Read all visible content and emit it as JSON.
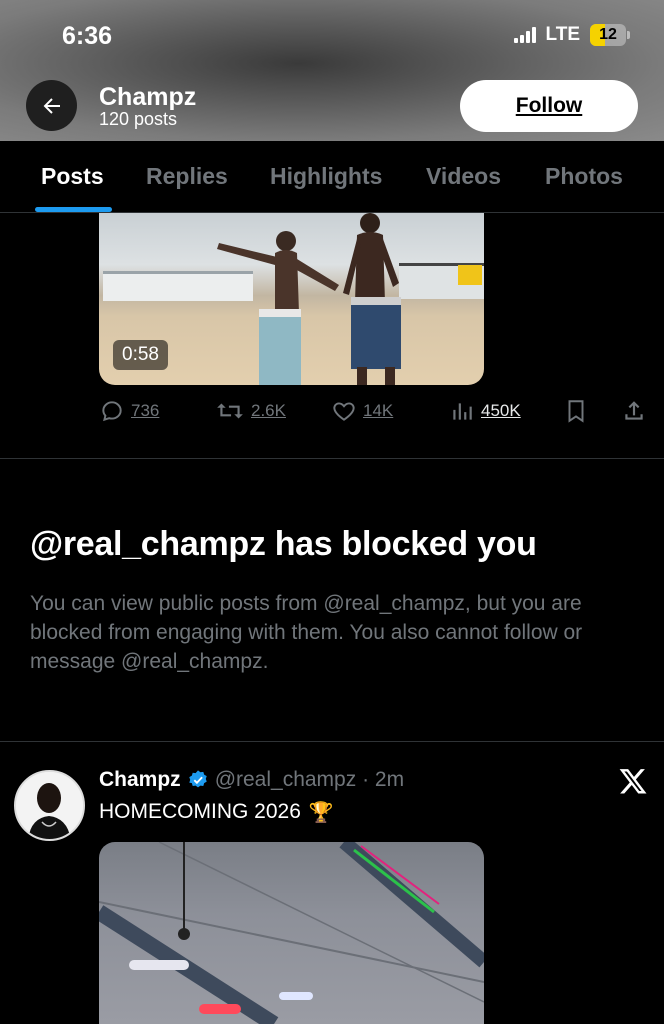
{
  "status_bar": {
    "time": "6:36",
    "network": "LTE",
    "battery": "12",
    "battery_level_percent": 12,
    "signal_bars": 4,
    "battery_color": "#f5d200"
  },
  "header": {
    "back_icon": "arrow-left-icon",
    "name": "Champz",
    "posts_count": "120 posts",
    "follow_label": "Follow"
  },
  "tabs": [
    {
      "label": "Posts",
      "active": true
    },
    {
      "label": "Replies",
      "active": false
    },
    {
      "label": "Highlights",
      "active": false
    },
    {
      "label": "Videos",
      "active": false
    },
    {
      "label": "Photos",
      "active": false
    }
  ],
  "post1": {
    "video_duration": "0:58",
    "actions": {
      "replies": "736",
      "reposts": "2.6K",
      "likes": "14K",
      "views": "450K"
    }
  },
  "blocked": {
    "title": "@real_champz has blocked you",
    "description": "You can view public posts from @real_champz, but you are blocked from engaging with them. You also cannot follow or message @real_champz."
  },
  "post2": {
    "author": "Champz",
    "handle_time": "@real_champz · 2m",
    "text": "HOMECOMING 2026",
    "emoji": "🏆"
  },
  "colors": {
    "accent": "#1d9bf0",
    "muted": "#71767b",
    "background": "#000000"
  }
}
